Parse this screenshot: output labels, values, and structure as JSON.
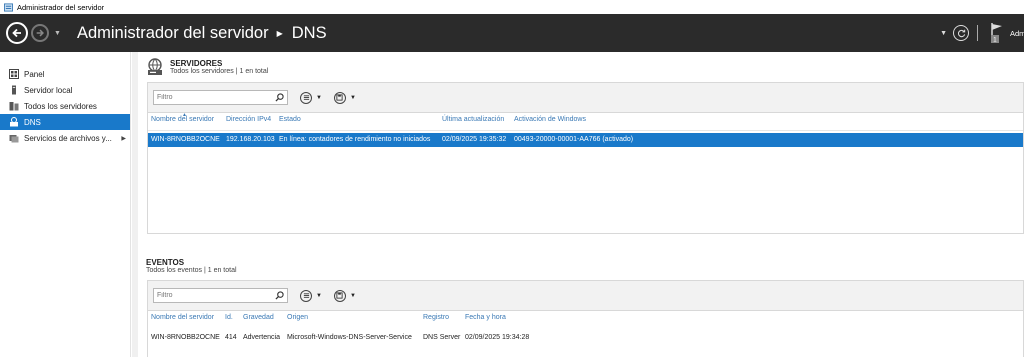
{
  "window": {
    "title": "Administrador del servidor"
  },
  "header": {
    "app": "Administrador del servidor",
    "page": "DNS",
    "manage_label": "Administrar"
  },
  "sidebar": {
    "items": [
      {
        "label": "Panel",
        "icon": "dashboard-icon"
      },
      {
        "label": "Servidor local",
        "icon": "local-server-icon"
      },
      {
        "label": "Todos los servidores",
        "icon": "all-servers-icon"
      },
      {
        "label": "DNS",
        "icon": "dns-icon",
        "active": true
      },
      {
        "label": "Servicios de archivos y...",
        "icon": "file-services-icon"
      }
    ]
  },
  "servers": {
    "title": "SERVIDORES",
    "subtitle": "Todos los servidores | 1 en total",
    "filter_placeholder": "Filtro",
    "columns": [
      "Nombre del servidor",
      "Dirección IPv4",
      "Estado",
      "Última actualización",
      "Activación de Windows"
    ],
    "rows": [
      {
        "name": "WIN-8RNOBB2OCNE",
        "ip": "192.168.20.103",
        "status": "En línea: contadores de rendimiento no iniciados",
        "updated": "02/09/2025 19:35:32",
        "activation": "00493-20000-00001-AA766 (activado)"
      }
    ]
  },
  "events": {
    "title": "EVENTOS",
    "subtitle": "Todos los eventos | 1 en total",
    "filter_placeholder": "Filtro",
    "columns": [
      "Nombre del servidor",
      "Id.",
      "Gravedad",
      "Origen",
      "Registro",
      "Fecha y hora"
    ],
    "rows": [
      {
        "server": "WIN-8RNOBB2OCNE",
        "id": "414",
        "severity": "Advertencia",
        "source": "Microsoft-Windows-DNS-Server-Service",
        "log": "DNS Server",
        "datetime": "02/09/2025 19:34:28"
      }
    ]
  },
  "colors": {
    "accent": "#1979ca",
    "header_bg": "#2b2b2b",
    "link": "#3a79b5"
  }
}
